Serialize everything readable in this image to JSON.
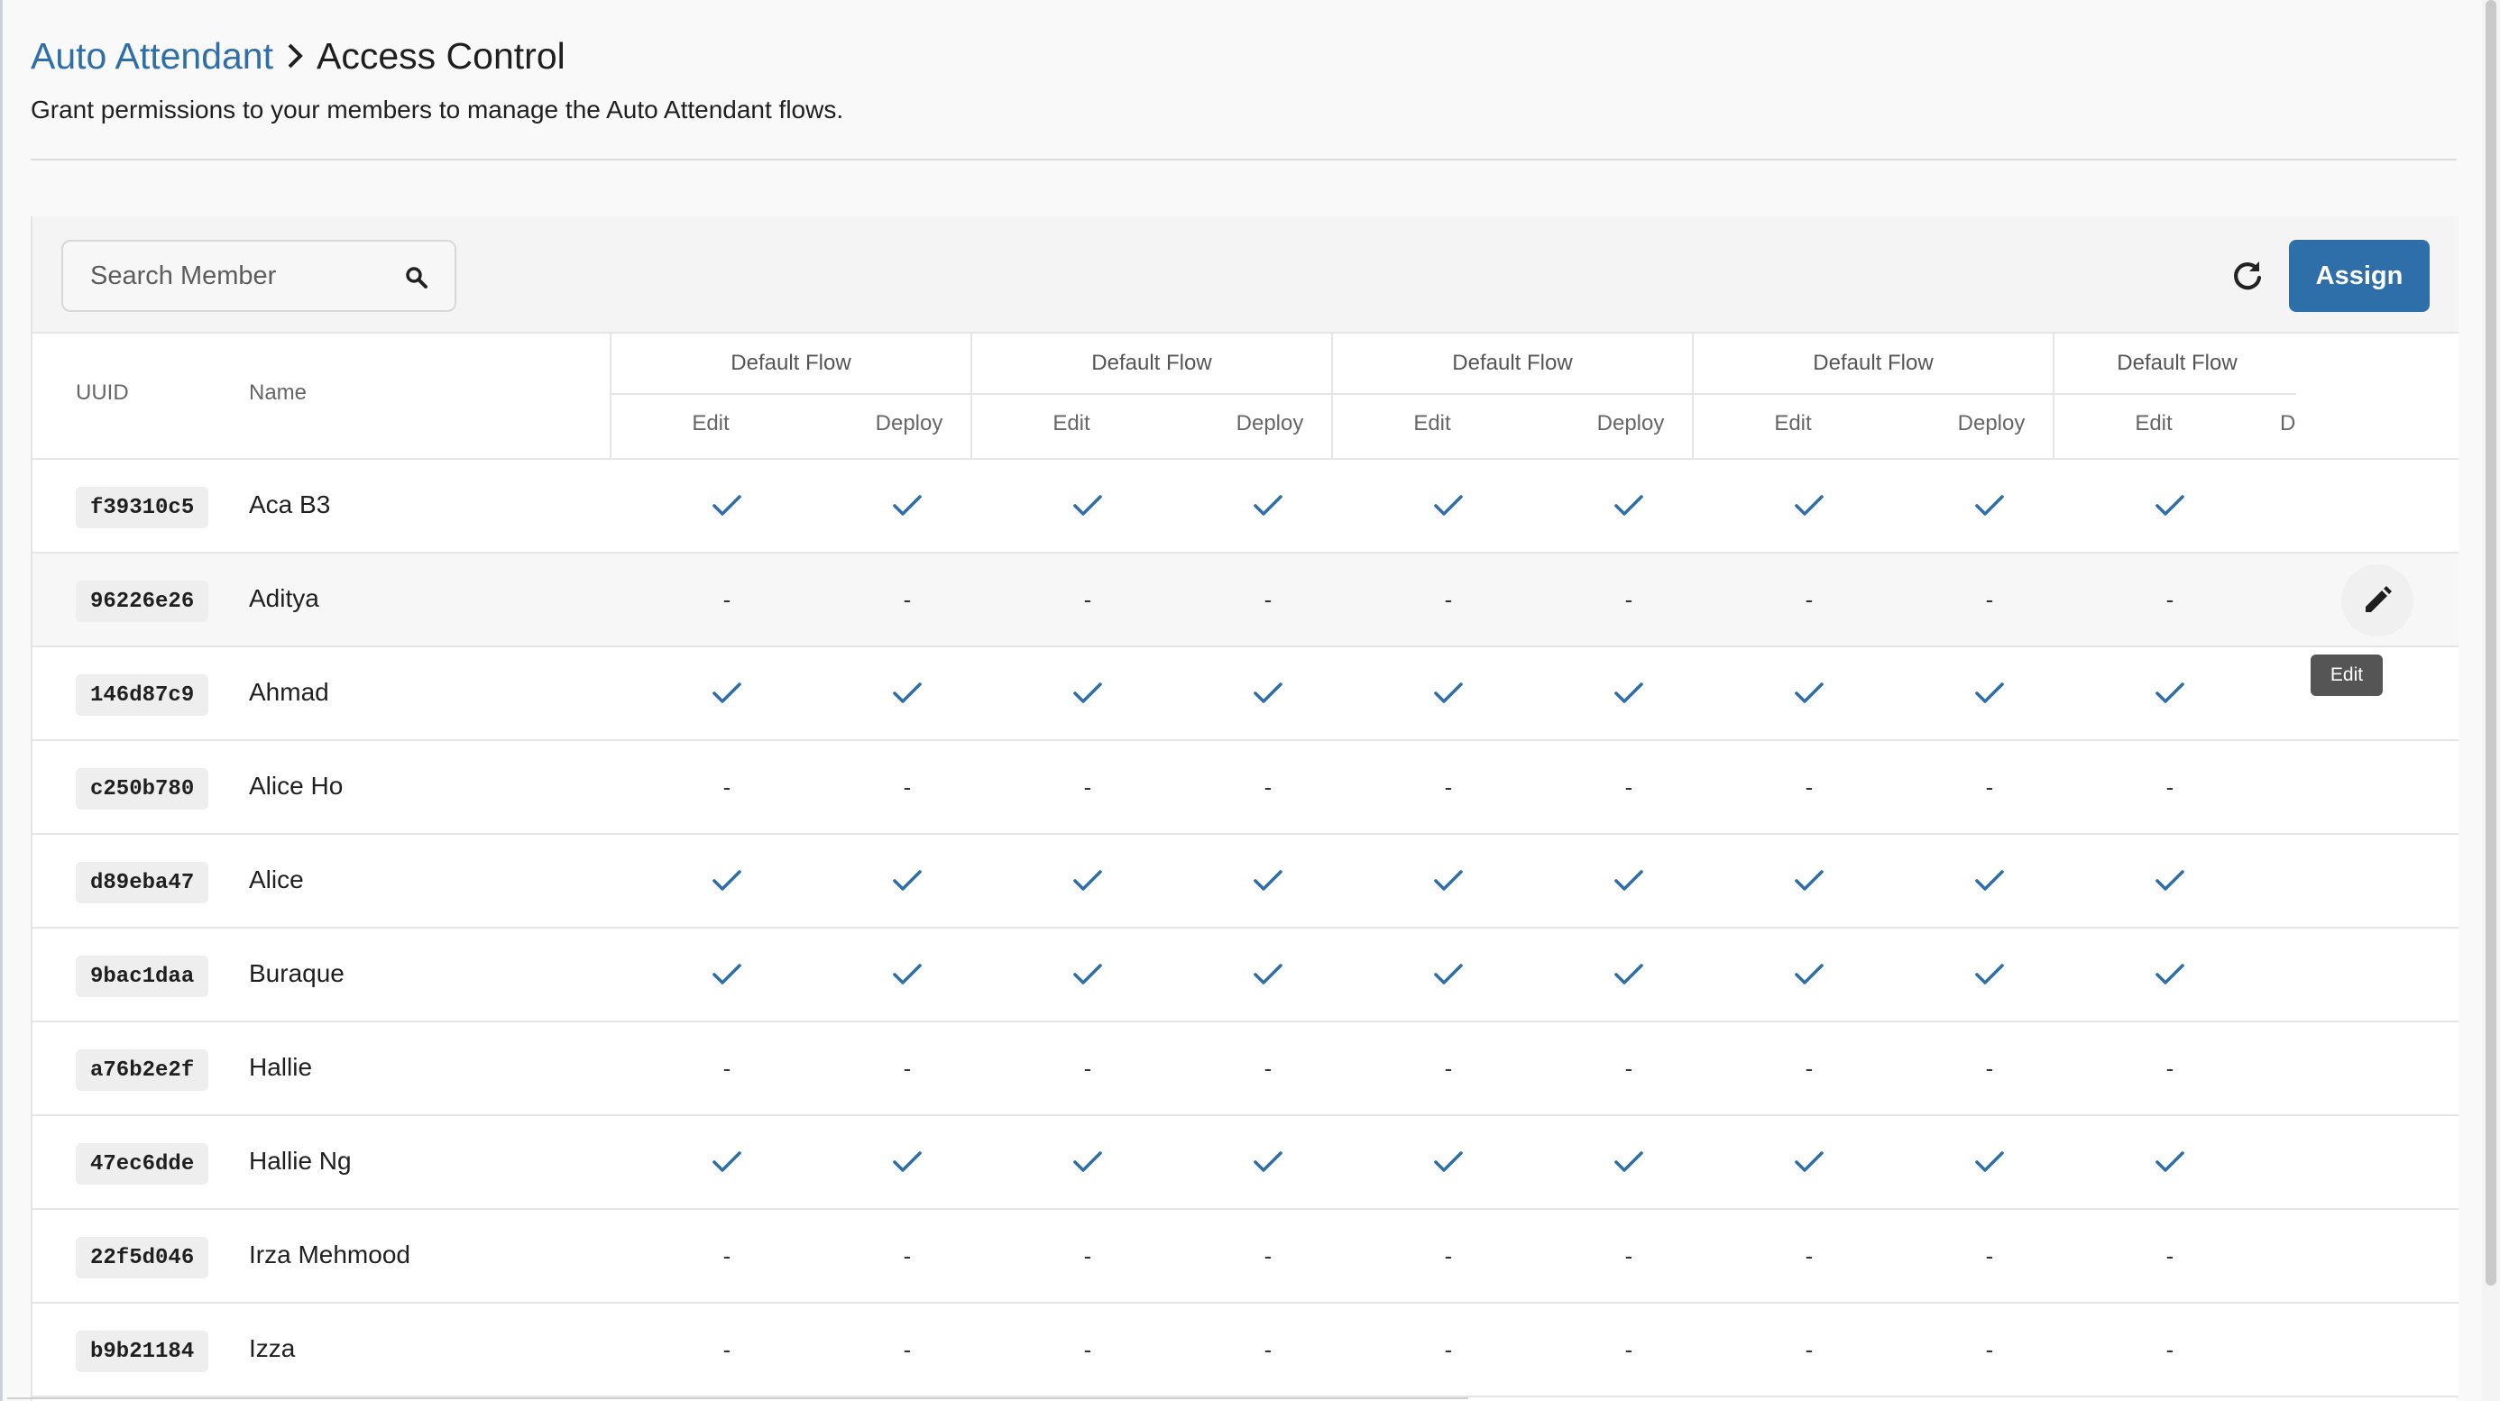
{
  "breadcrumb": {
    "parent": "Auto Attendant",
    "separator_icon": "chevron-right-icon",
    "current": "Access Control"
  },
  "subtitle": "Grant permissions to your members to manage the Auto Attendant flows.",
  "toolbar": {
    "search_placeholder": "Search Member",
    "search_icon": "search-icon",
    "refresh_icon": "refresh-icon",
    "assign_label": "Assign"
  },
  "table": {
    "col_uuid": "UUID",
    "col_name": "Name",
    "flows": [
      {
        "title": "Default Flow",
        "edit": "Edit",
        "deploy": "Deploy"
      },
      {
        "title": "Default Flow",
        "edit": "Edit",
        "deploy": "Deploy"
      },
      {
        "title": "Default Flow",
        "edit": "Edit",
        "deploy": "Deploy"
      },
      {
        "title": "Default Flow",
        "edit": "Edit",
        "deploy": "Deploy"
      },
      {
        "title": "Default Flow",
        "edit": "Edit",
        "deploy": "D"
      }
    ],
    "rows": [
      {
        "uuid": "f39310c5",
        "name": "Aca B3",
        "granted": true
      },
      {
        "uuid": "96226e26",
        "name": "Aditya",
        "granted": false
      },
      {
        "uuid": "146d87c9",
        "name": "Ahmad",
        "granted": true
      },
      {
        "uuid": "c250b780",
        "name": "Alice Ho",
        "granted": false
      },
      {
        "uuid": "d89eba47",
        "name": "Alice",
        "granted": true
      },
      {
        "uuid": "9bac1daa",
        "name": "Buraque",
        "granted": true
      },
      {
        "uuid": "a76b2e2f",
        "name": "Hallie",
        "granted": false
      },
      {
        "uuid": "47ec6dde",
        "name": "Hallie Ng",
        "granted": true
      },
      {
        "uuid": "22f5d046",
        "name": "Irza Mehmood",
        "granted": false
      },
      {
        "uuid": "b9b21184",
        "name": "Izza",
        "granted": false
      }
    ],
    "dash": "-",
    "hovered_row": 1,
    "edit_icon": "pencil-icon",
    "edit_tooltip": "Edit"
  },
  "colors": {
    "accent": "#2f6fa9",
    "check": "#2f6fa9"
  }
}
